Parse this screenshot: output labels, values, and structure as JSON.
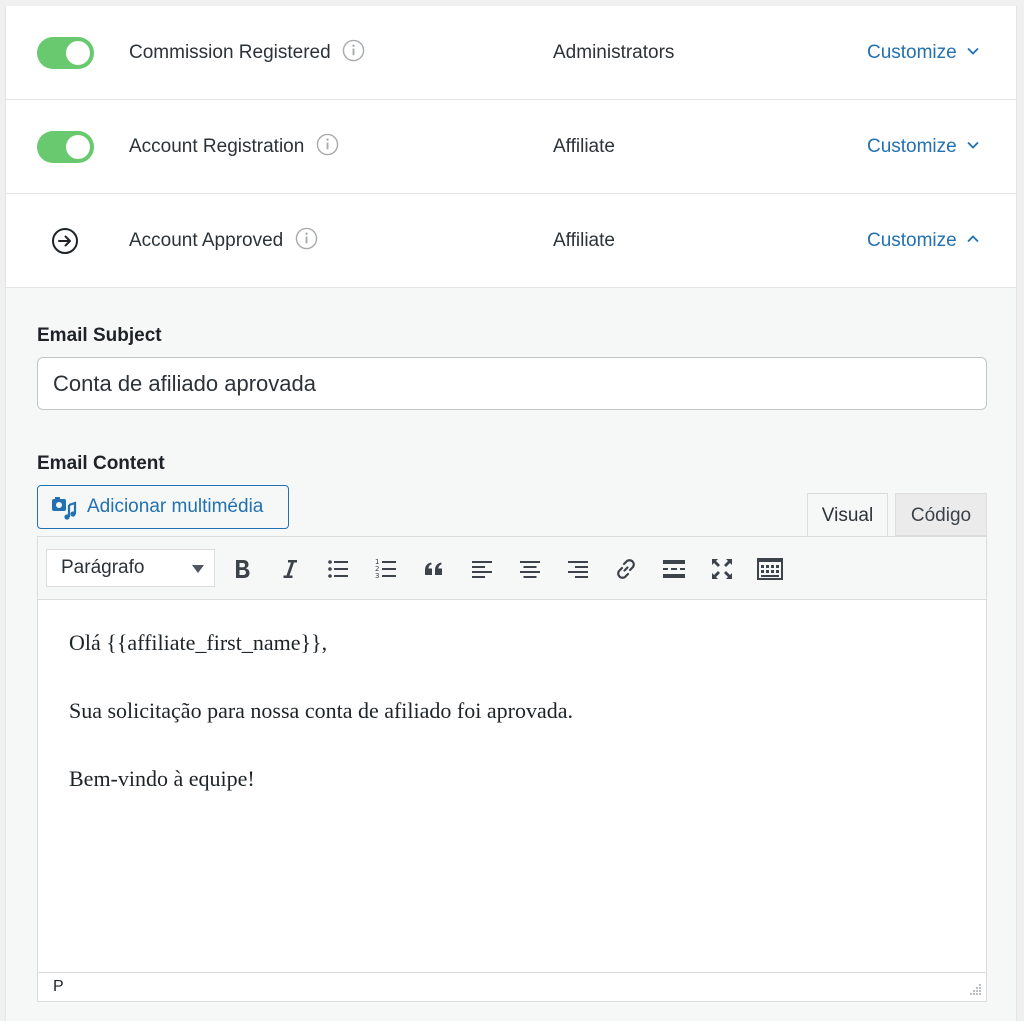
{
  "notifications": [
    {
      "name": "Commission Registered",
      "recipient": "Administrators",
      "customize_label": "Customize",
      "state": "enabled",
      "expanded": false
    },
    {
      "name": "Account Registration",
      "recipient": "Affiliate",
      "customize_label": "Customize",
      "state": "enabled",
      "expanded": false
    },
    {
      "name": "Account Approved",
      "recipient": "Affiliate",
      "customize_label": "Customize",
      "state": "manual",
      "expanded": true
    }
  ],
  "email": {
    "subject_label": "Email Subject",
    "subject_value": "Conta de afiliado aprovada",
    "content_label": "Email Content",
    "add_media_label": "Adicionar multimédia",
    "tabs": [
      "Visual",
      "Código"
    ],
    "active_tab": "Visual",
    "format_select": "Parágrafo",
    "body": [
      "Olá {{affiliate_first_name}},",
      "Sua solicitação para nossa conta de afiliado foi aprovada.",
      "Bem-vindo à equipe!"
    ],
    "status_path": "P"
  },
  "colors": {
    "toggle_on": "#68c96e",
    "link": "#2271b1"
  }
}
